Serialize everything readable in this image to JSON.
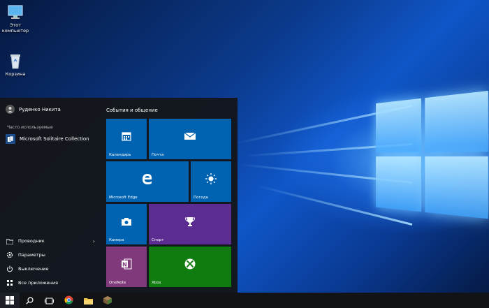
{
  "desktop": {
    "icons": [
      {
        "label": "Этот компьютер",
        "icon": "computer-icon"
      },
      {
        "label": "Корзина",
        "icon": "recycle-bin-icon"
      }
    ]
  },
  "start_menu": {
    "user_name": "Руденко Никита",
    "frequent_label": "Часто используемые",
    "frequent_apps": [
      {
        "label": "Microsoft Solitaire Collection",
        "icon": "solitaire-icon"
      }
    ],
    "bottom_items": [
      {
        "label": "Проводник",
        "icon": "file-explorer-icon"
      },
      {
        "label": "Параметры",
        "icon": "settings-gear-icon"
      },
      {
        "label": "Выключение",
        "icon": "power-icon"
      },
      {
        "label": "Все приложения",
        "icon": "all-apps-icon"
      }
    ],
    "tiles_group_title": "События и общение",
    "tiles": [
      {
        "label": "Календарь",
        "icon": "calendar-icon",
        "color": "#0063b1"
      },
      {
        "label": "Почта",
        "icon": "mail-icon",
        "color": "#0063b1"
      },
      {
        "label": "Microsoft Edge",
        "icon": "edge-icon",
        "color": "#0063b1"
      },
      {
        "label": "Погода",
        "icon": "weather-sun-icon",
        "color": "#0063b1"
      },
      {
        "label": "Камера",
        "icon": "camera-icon",
        "color": "#0063b1"
      },
      {
        "label": "Спорт",
        "icon": "trophy-icon",
        "color": "#5c2d91"
      },
      {
        "label": "OneNote",
        "icon": "onenote-icon",
        "color": "#80397b"
      },
      {
        "label": "Xbox",
        "icon": "xbox-icon",
        "color": "#107c10"
      }
    ]
  },
  "taskbar": {
    "buttons": [
      {
        "icon": "windows-start-icon"
      },
      {
        "icon": "search-icon"
      },
      {
        "icon": "task-view-icon"
      },
      {
        "icon": "chrome-icon"
      },
      {
        "icon": "file-explorer-icon"
      },
      {
        "icon": "app-icon"
      }
    ]
  }
}
